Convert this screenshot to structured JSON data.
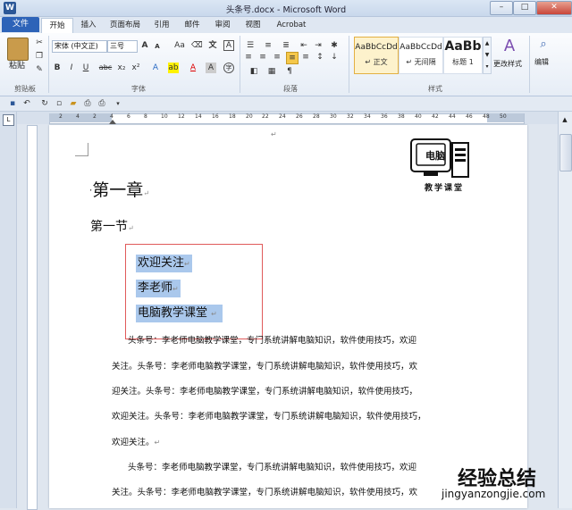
{
  "window": {
    "title": "头条号.docx - Microsoft Word",
    "minimize": "–",
    "maximize": "□",
    "close": "✕"
  },
  "tabs": [
    "文件",
    "开始",
    "插入",
    "页面布局",
    "引用",
    "邮件",
    "审阅",
    "视图",
    "Acrobat"
  ],
  "ribbon": {
    "clipboard": {
      "paste_label": "粘贴",
      "group_label": "剪贴板"
    },
    "font": {
      "font_name": "宋体 (中文正)",
      "font_size": "三号",
      "group_label": "字体"
    },
    "paragraph": {
      "group_label": "段落"
    },
    "styles": {
      "items": [
        {
          "sample": "AaBbCcDd",
          "name": "↵ 正文"
        },
        {
          "sample": "AaBbCcDd",
          "name": "↵ 无间隔"
        },
        {
          "sample": "AaBb",
          "name": "标题 1"
        }
      ],
      "change_styles": "更改样式",
      "group_label": "样式"
    },
    "editing": {
      "label": "编辑"
    }
  },
  "ruler": {
    "ticks": [
      "2",
      "4",
      "2",
      "4",
      "6",
      "8",
      "10",
      "12",
      "14",
      "16",
      "18",
      "20",
      "22",
      "24",
      "26",
      "28",
      "30",
      "32",
      "34",
      "36",
      "38",
      "40",
      "42",
      "44",
      "46",
      "48",
      "50"
    ]
  },
  "document": {
    "heading1": "第一章",
    "heading2": "第一节",
    "selected_lines": [
      "欢迎关注",
      "李老师",
      "电脑教学课堂"
    ],
    "paragraph1_lines": [
      "头条号：李老师电脑教学课堂，专门系统讲解电脑知识，软件使用技巧，欢迎",
      "关注。头条号：李老师电脑教学课堂，专门系统讲解电脑知识，软件使用技巧，欢",
      "迎关注。头条号：李老师电脑教学课堂，专门系统讲解电脑知识，软件使用技巧，",
      "欢迎关注。头条号：李老师电脑教学课堂，专门系统讲解电脑知识，软件使用技巧，",
      "欢迎关注。"
    ],
    "paragraph2_lines": [
      "头条号：李老师电脑教学课堂，专门系统讲解电脑知识，软件使用技巧，欢迎",
      "关注。头条号：李老师电脑教学课堂，专门系统讲解电脑知识，软件使用技巧，欢"
    ],
    "paragraph_mark": "↵"
  },
  "logo": {
    "screen_text": "电脑",
    "caption": "教学课堂"
  },
  "watermark": {
    "main": "经验总结",
    "url": "jingyanzongjie.com"
  }
}
